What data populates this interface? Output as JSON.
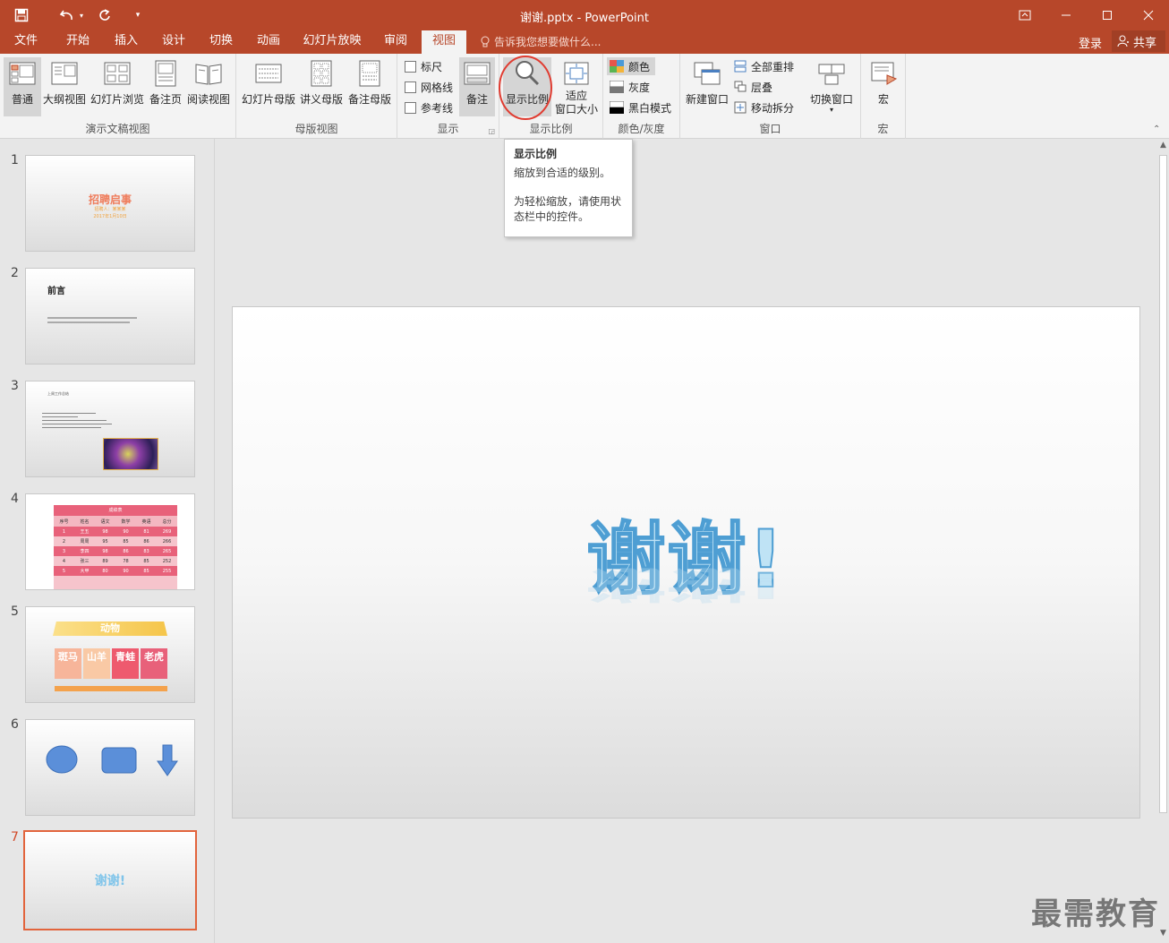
{
  "window": {
    "title": "谢谢.pptx - PowerPoint",
    "qat": {
      "save_icon": "save-icon",
      "undo_icon": "undo-icon",
      "redo_icon": "redo-icon",
      "customize_icon": "customize-icon"
    }
  },
  "tabs": [
    {
      "label": "文件"
    },
    {
      "label": "开始"
    },
    {
      "label": "插入"
    },
    {
      "label": "设计"
    },
    {
      "label": "切换"
    },
    {
      "label": "动画"
    },
    {
      "label": "幻灯片放映"
    },
    {
      "label": "审阅"
    },
    {
      "label": "视图"
    }
  ],
  "active_tab": "视图",
  "tell_me": "告诉我您想要做什么...",
  "login": "登录",
  "share": "共享",
  "ribbon": {
    "presentation_views": {
      "label": "演示文稿视图",
      "normal": "普通",
      "outline": "大纲视图",
      "slide_sorter": "幻灯片浏览",
      "notes_page": "备注页",
      "reading": "阅读视图"
    },
    "master_views": {
      "label": "母版视图",
      "slide_master": "幻灯片母版",
      "handout_master": "讲义母版",
      "notes_master": "备注母版"
    },
    "show": {
      "label": "显示",
      "ruler": "标尺",
      "gridlines": "网格线",
      "guides": "参考线",
      "notes": "备注"
    },
    "zoom": {
      "label": "显示比例",
      "zoom": "显示比例",
      "fit_line1": "适应",
      "fit_line2": "窗口大小"
    },
    "color": {
      "label": "颜色/灰度",
      "color": "颜色",
      "grayscale": "灰度",
      "bw": "黑白模式"
    },
    "window": {
      "label": "窗口",
      "new_window": "新建窗口",
      "arrange_all": "全部重排",
      "cascade": "层叠",
      "move_split": "移动拆分",
      "switch": "切换窗口"
    },
    "macros": {
      "label": "宏",
      "macros": "宏"
    }
  },
  "tooltip": {
    "title": "显示比例",
    "line1": "缩放到合适的级别。",
    "line2": "为轻松缩放，请使用状态栏中的控件。"
  },
  "slides": [
    {
      "num": "1",
      "title": "招聘启事",
      "subtitle": "招聘人：某某某",
      "date": "2017年1月10日"
    },
    {
      "num": "2",
      "title": "前言"
    },
    {
      "num": "3",
      "title": "上周工作总结"
    },
    {
      "num": "4",
      "title": "成绩表",
      "headers": [
        "序号",
        "姓名",
        "语文",
        "数学",
        "英语",
        "总分"
      ],
      "rows": [
        [
          "1",
          "王五",
          "98",
          "90",
          "81",
          "269"
        ],
        [
          "2",
          "周周",
          "95",
          "85",
          "86",
          "266"
        ],
        [
          "3",
          "李四",
          "98",
          "86",
          "83",
          "265"
        ],
        [
          "4",
          "张三",
          "89",
          "78",
          "85",
          "252"
        ],
        [
          "5",
          "大甲",
          "80",
          "90",
          "85",
          "255"
        ]
      ]
    },
    {
      "num": "5",
      "title": "动物",
      "cards": [
        "斑马",
        "山羊",
        "青蛙",
        "老虎"
      ]
    },
    {
      "num": "6"
    },
    {
      "num": "7",
      "title": "谢谢!"
    }
  ],
  "current_slide": {
    "text": "谢谢!"
  },
  "watermark": "最需教育",
  "colors": {
    "accent": "#b7472a",
    "selected_border": "#e2643c"
  }
}
